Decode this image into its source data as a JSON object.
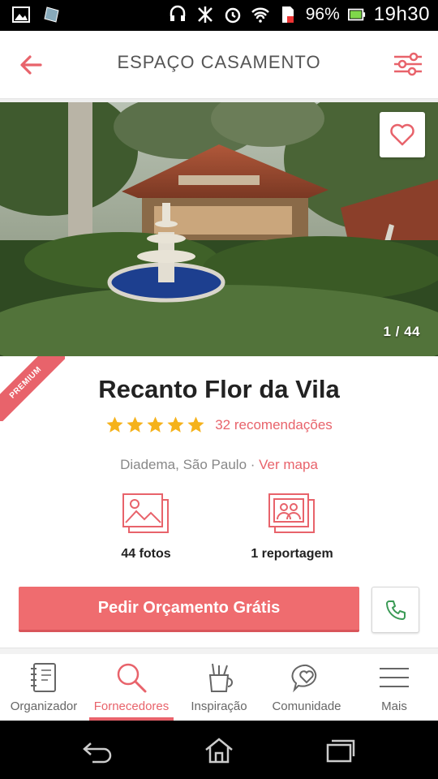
{
  "status_bar": {
    "battery_percent": "96%",
    "time": "19h30"
  },
  "header": {
    "title": "ESPAÇO CASAMENTO",
    "back_icon": "arrow-left-icon",
    "filter_icon": "sliders-icon"
  },
  "hero": {
    "photo_counter": "1 / 44",
    "favorite_icon": "heart-icon"
  },
  "venue": {
    "badge": "PREMIUM",
    "name": "Recanto Flor da Vila",
    "rating_stars": 5,
    "recommendations": "32 recomendações",
    "location": "Diadema, São Paulo",
    "location_separator": " · ",
    "map_link": "Ver mapa"
  },
  "media": [
    {
      "label": "44 fotos",
      "icon": "photos-icon"
    },
    {
      "label": "1 reportagem",
      "icon": "report-icon"
    }
  ],
  "actions": {
    "quote_button": "Pedir Orçamento Grátis",
    "call_icon": "phone-icon"
  },
  "bottom_nav": [
    {
      "label": "Organizador",
      "icon": "notebook-icon"
    },
    {
      "label": "Fornecedores",
      "icon": "search-icon",
      "active": true
    },
    {
      "label": "Inspiração",
      "icon": "pencil-cup-icon"
    },
    {
      "label": "Comunidade",
      "icon": "chat-heart-icon"
    },
    {
      "label": "Mais",
      "icon": "menu-icon"
    }
  ],
  "colors": {
    "accent": "#e8636b",
    "button": "#ef6c6f",
    "call_green": "#3a9a55",
    "star": "#f5b21b"
  }
}
